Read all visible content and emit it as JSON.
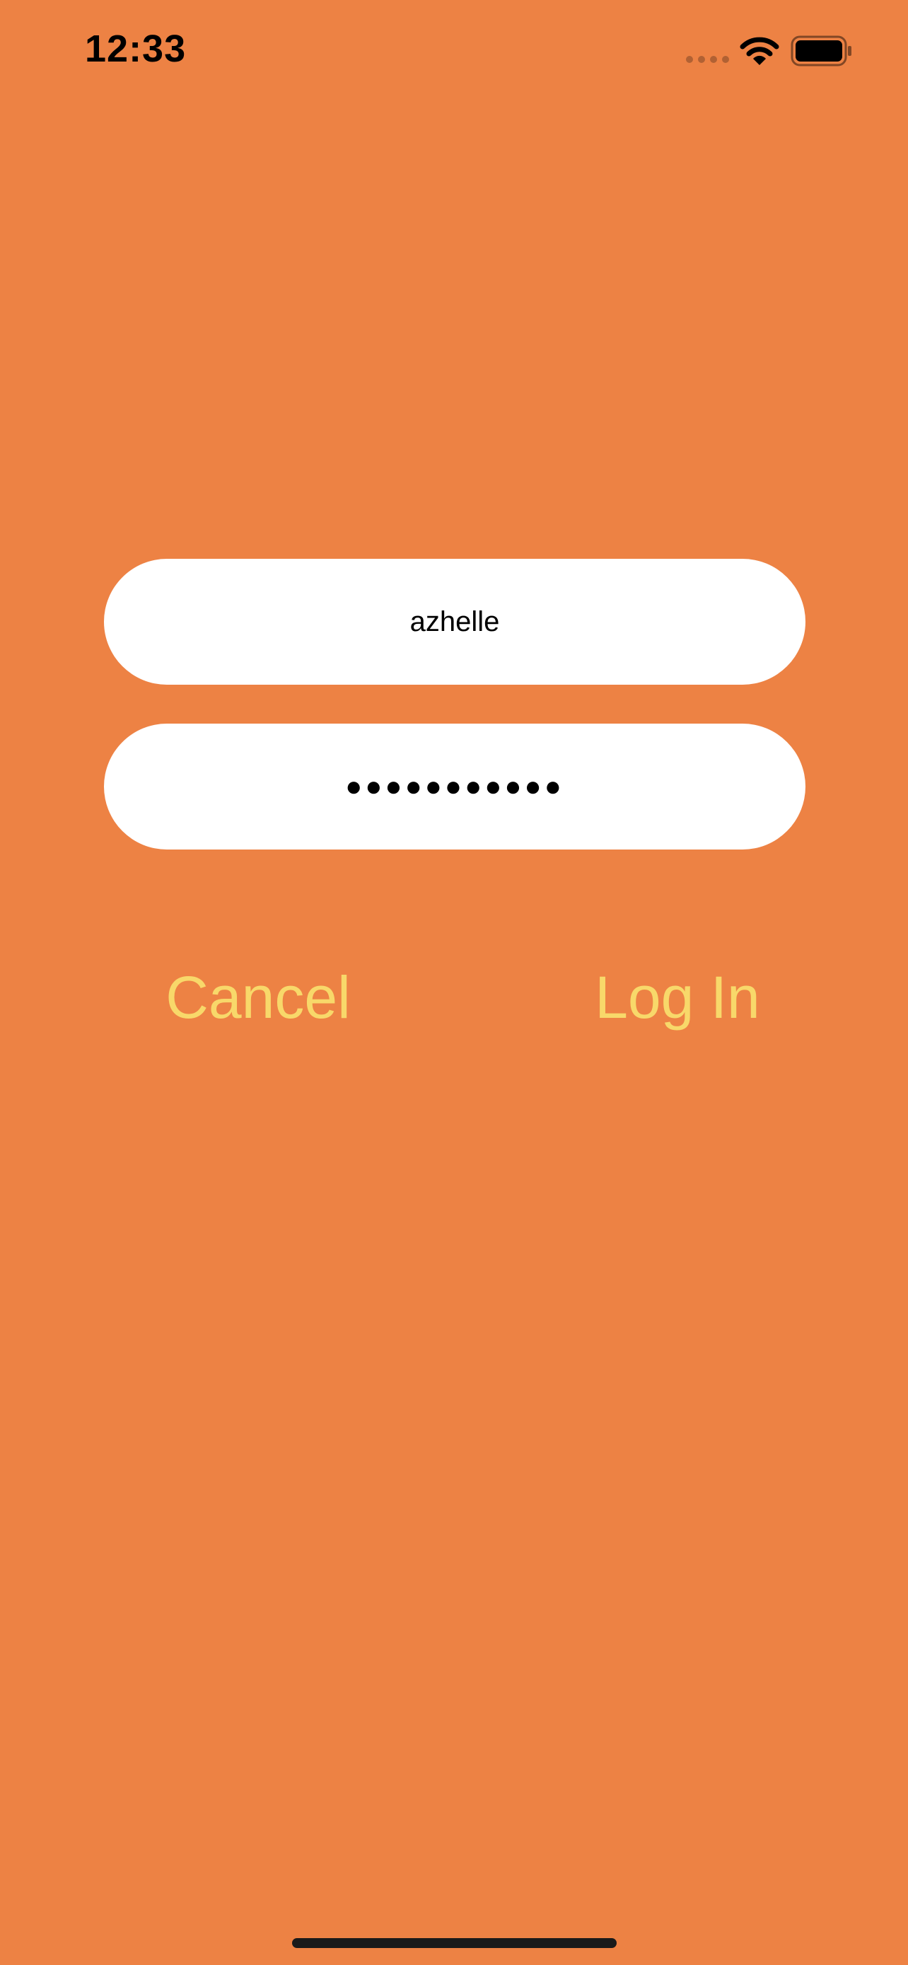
{
  "status_bar": {
    "time": "12:33",
    "icons": [
      "cellular-signal-icon",
      "wifi-icon",
      "battery-icon"
    ]
  },
  "login_form": {
    "username_value": "azhelle",
    "password_value": "●●●●●●●●●●●"
  },
  "actions": {
    "cancel_label": "Cancel",
    "login_label": "Log In"
  },
  "colors": {
    "background": "#ED8244",
    "field_background": "#FFFFFF",
    "button_text": "#F8D86A",
    "home_indicator": "#1A1A1A"
  }
}
